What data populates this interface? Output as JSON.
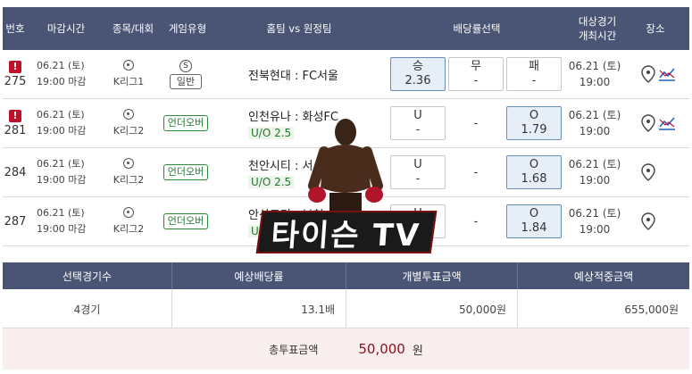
{
  "header": {
    "no": "번호",
    "deadline": "마감시간",
    "league": "종목/대회",
    "game_type": "게임유형",
    "match": "홈팀 vs 원정팀",
    "odds": "배당률선택",
    "event_time_l1": "대상경기",
    "event_time_l2": "개최시간",
    "place": "장소"
  },
  "rows": [
    {
      "alert": "!",
      "no": "275",
      "date": "06.21 (토)",
      "deadline": "19:00 마감",
      "league": "K리그1",
      "type_badge": "S",
      "type": "일반",
      "match": "전북현대 : FC서울",
      "ou": "",
      "left_label": "승",
      "left_value": "2.36",
      "mid_label": "무",
      "mid_value": "-",
      "right_label": "패",
      "right_value": "-",
      "event_date": "06.21 (토)",
      "event_time": "19:00"
    },
    {
      "alert": "!",
      "no": "281",
      "date": "06.21 (토)",
      "deadline": "19:00 마감",
      "league": "K리그2",
      "type": "언더오버",
      "match": "인천유나 : 화성FC",
      "ou": "U/O 2.5",
      "left_label": "U",
      "left_value": "-",
      "mid_value": "-",
      "right_label": "O",
      "right_value": "1.79",
      "event_date": "06.21 (토)",
      "event_time": "19:00"
    },
    {
      "alert": "",
      "no": "284",
      "date": "06.21 (토)",
      "deadline": "19:00 마감",
      "league": "K리그2",
      "type": "언더오버",
      "match": "천안시티 : 서",
      "ou": "U/O 2.5",
      "left_label": "U",
      "left_value": "-",
      "mid_value": "-",
      "right_label": "O",
      "right_value": "1.68",
      "event_date": "06.21 (토)",
      "event_time": "19:00"
    },
    {
      "alert": "",
      "no": "287",
      "date": "06.21 (토)",
      "deadline": "19:00 마감",
      "league": "K리그2",
      "type": "언더오버",
      "match": "안산그리 : 부천",
      "ou": "U",
      "left_label": "U",
      "left_value": "-",
      "mid_value": "-",
      "right_label": "O",
      "right_value": "1.84",
      "event_date": "06.21 (토)",
      "event_time": "19:00"
    }
  ],
  "summary": {
    "h_count": "선택경기수",
    "h_odds": "예상배당률",
    "h_stake": "개별투표금액",
    "h_payout": "예상적중금액",
    "count": "4경기",
    "odds": "13.1배",
    "stake": "50,000원",
    "payout": "655,000원",
    "total_label": "총투표금액",
    "total_value": "50,000",
    "total_unit": "원"
  },
  "watermark": "타이슨 TV",
  "icons": {
    "alert": "alert-icon",
    "ball": "soccer-ball-icon",
    "pin": "location-pin-icon",
    "graph": "trend-chart-icon"
  },
  "colors": {
    "header_bg": "#4a5474",
    "alert": "#c0102a",
    "ou_green": "#1f7a30",
    "selected_odd": "#e6eef8",
    "total_value": "#8a1020"
  }
}
